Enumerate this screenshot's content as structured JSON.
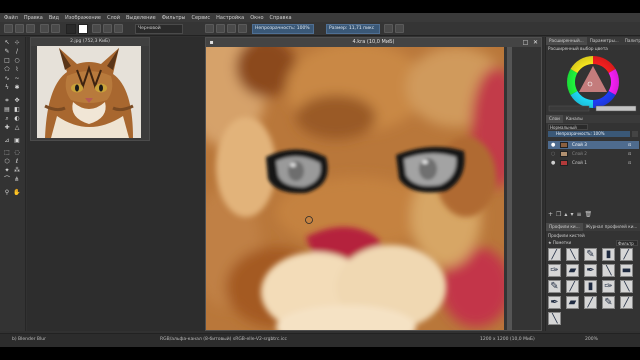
{
  "menubar": {
    "items": [
      "Файл",
      "Правка",
      "Вид",
      "Изображение",
      "Слой",
      "Выделение",
      "Фильтры",
      "Сервис",
      "Настройка",
      "Окно",
      "Справка"
    ]
  },
  "toolbar": {
    "brush_preset": "Черновой",
    "opacity_label": "Непрозрачность: 100%",
    "size_label": "Размер: 11,71 пикс",
    "fg_color": "#2a2a2a",
    "bg_color": "#ffffff"
  },
  "reference": {
    "title": "2.jpg (752,3 КиБ)"
  },
  "document": {
    "title": "4.kra (10,0 МиБ)"
  },
  "dock": {
    "color_tabs": [
      "Расширенный...",
      "Параметры...",
      "Палитра"
    ],
    "color_selector_title": "Расширенный выбор цвета",
    "layer_tabs": [
      "Слои",
      "Каналы"
    ],
    "layer_mode": "Нормальный",
    "layer_opacity": "Непрозрачность: 100%",
    "layers": [
      {
        "name": "Слой 3",
        "thumb": "#8a6040",
        "active": true
      },
      {
        "name": "Слой 2",
        "thumb": "#b09070",
        "active": false
      },
      {
        "name": "Слой 1",
        "thumb": "#b33a3a",
        "active": false
      }
    ],
    "brush_tabs": [
      "Профили ки...",
      "Журнал профилей ки..."
    ],
    "brush_filter_label": "Профили кистей",
    "brush_tag": "★ Пометки",
    "brush_filter": "Фильтр"
  },
  "statusbar": {
    "tool": "b) Blender Blur",
    "color_info": "RGB/альфа-канал (8-битовый) sRGB-elle-V2-srgbtrc.icc",
    "dimensions": "1200 x 1200 (10,0 МиБ)",
    "zoom": "200%"
  },
  "colors": {
    "accent": "#4e6b8e",
    "lip_red": "#b3203a"
  }
}
